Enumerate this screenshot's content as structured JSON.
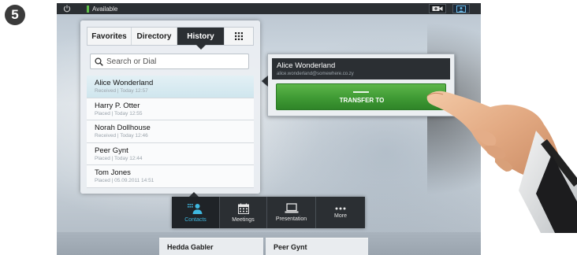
{
  "step_badge": "5",
  "status_bar": {
    "status_text": "Available"
  },
  "tabs": {
    "favorites": "Favorites",
    "directory": "Directory",
    "history": "History"
  },
  "search": {
    "placeholder": "Search or Dial"
  },
  "history": [
    {
      "name": "Alice Wonderland",
      "detail": "Received | Today 12:57"
    },
    {
      "name": "Harry P. Otter",
      "detail": "Placed | Today 12:55"
    },
    {
      "name": "Norah Dollhouse",
      "detail": "Received | Today 12:46"
    },
    {
      "name": "Peer Gynt",
      "detail": "Placed | Today 12:44"
    },
    {
      "name": "Tom Jones",
      "detail": "Placed | 05.09.2011 14:51"
    }
  ],
  "detail": {
    "name": "Alice Wonderland",
    "email": "alice.wonderland@somewhere.co.zy",
    "transfer_label": "TRANSFER TO"
  },
  "nav": {
    "contacts": "Contacts",
    "meetings": "Meetings",
    "presentation": "Presentation",
    "more": "More"
  },
  "bottom_cards": {
    "left": "Hedda Gabler",
    "right": "Peer Gynt"
  },
  "colors": {
    "accent_green": "#3f9a34",
    "accent_blue": "#3fb8e0",
    "status_green": "#5fc14a",
    "dark_ui": "#2b2f33"
  }
}
